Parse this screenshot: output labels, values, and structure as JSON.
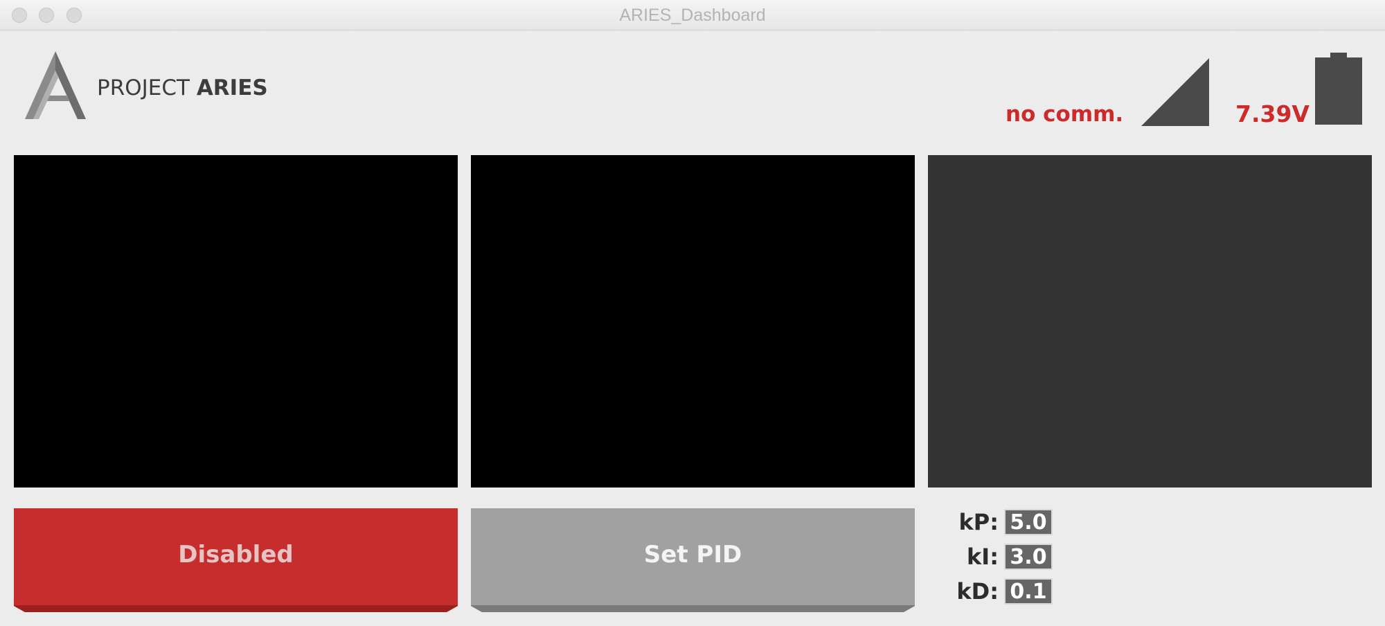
{
  "window": {
    "title": "ARIES_Dashboard"
  },
  "logo": {
    "prefix": "PROJECT",
    "name": "ARIES"
  },
  "status": {
    "comm_text": "no comm.",
    "voltage_text": "7.39V",
    "signal_icon": "signal-strength-icon",
    "battery_icon": "battery-icon",
    "alert_color": "#cc2b2b"
  },
  "panels": [
    "camera-feed-1",
    "camera-feed-2",
    "camera-feed-3"
  ],
  "buttons": {
    "enable_label": "Disabled",
    "set_pid_label": "Set PID"
  },
  "pid": {
    "kp_label": "kP:",
    "kp_value": "5.0",
    "ki_label": "kI:",
    "ki_value": "3.0",
    "kd_label": "kD:",
    "kd_value": "0.1"
  },
  "colors": {
    "disabled_button": "#c62d2d",
    "set_pid_button": "#a1a1a1",
    "background": "#ececec"
  }
}
